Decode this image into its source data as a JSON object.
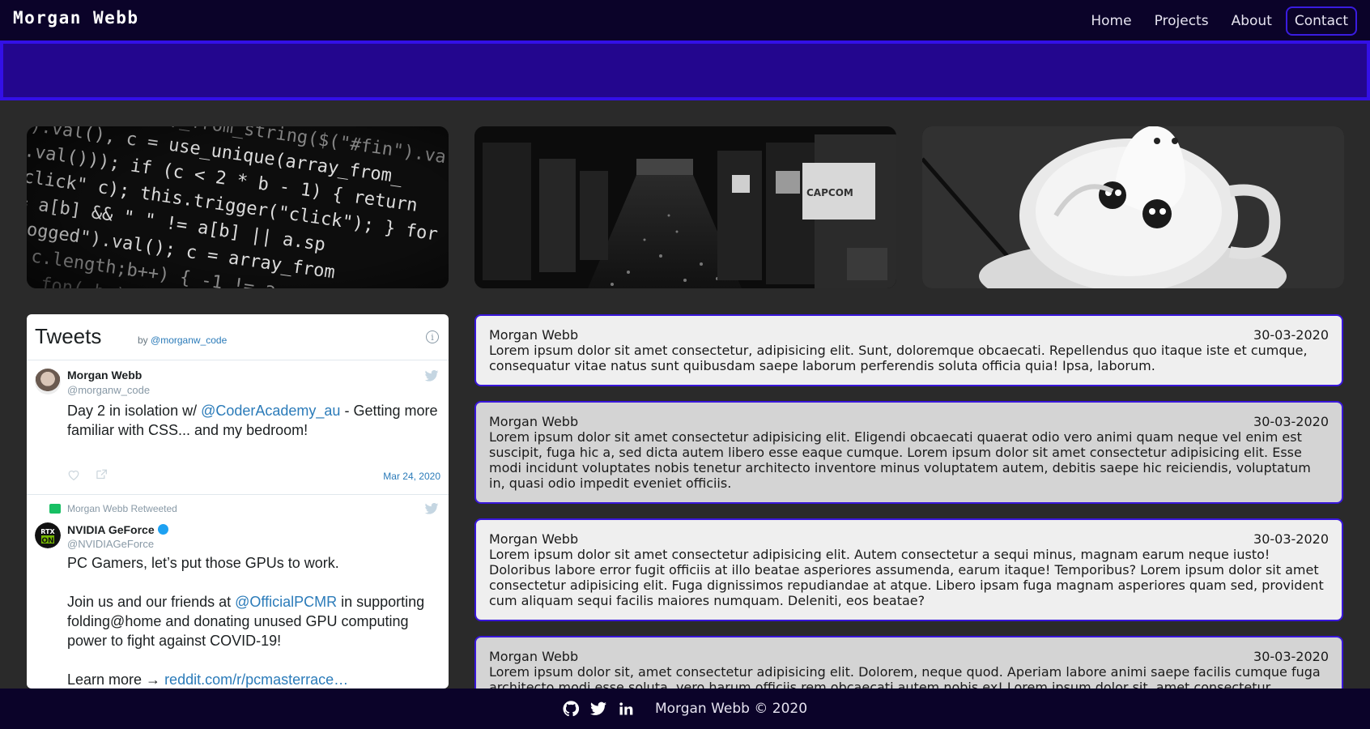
{
  "nav": {
    "brand": "Morgan Webb",
    "links": [
      {
        "label": "Home"
      },
      {
        "label": "Projects"
      },
      {
        "label": "About"
      },
      {
        "label": "Contact",
        "active": true
      }
    ]
  },
  "gallery": [
    {
      "name": "code-screen-image",
      "caption": "tring($(\"#fin\").va, c = use_unique(array_from_, this.trigger(\"click\"); } return"
    },
    {
      "name": "arcade-image",
      "caption": "CAPCOM"
    },
    {
      "name": "latte-art-image",
      "caption": ""
    }
  ],
  "tweets": {
    "title": "Tweets",
    "by": "by",
    "by_handle": "@morganw_code",
    "items": [
      {
        "name": "Morgan Webb",
        "handle": "@morganw_code",
        "text_pre": "Day 2 in isolation w/ ",
        "text_link": "@CoderAcademy_au",
        "text_post": " - Getting more familiar with CSS... and my bedroom!",
        "date": "Mar 24, 2020"
      },
      {
        "retweet_label": "Morgan Webb Retweeted",
        "name": "NVIDIA GeForce",
        "handle": "@NVIDIAGeForce",
        "line1": "PC Gamers, let’s put those GPUs to work.",
        "line2_pre": "Join us and our friends at ",
        "line2_link": "@OfficialPCMR",
        "line2_post": " in supporting folding@home and donating unused GPU computing power to fight against COVID-19!",
        "line3_pre": "Learn more → ",
        "line3_link": "reddit.com/r/pcmasterrace…"
      }
    ]
  },
  "posts": [
    {
      "author": "Morgan Webb",
      "date": "30-03-2020",
      "body": "Lorem ipsum dolor sit amet consectetur, adipisicing elit. Sunt, doloremque obcaecati. Repellendus quo itaque iste et cumque, consequatur vitae natus sunt quibusdam saepe laborum perferendis soluta officia quia! Ipsa, laborum."
    },
    {
      "author": "Morgan Webb",
      "date": "30-03-2020",
      "body": "Lorem ipsum dolor sit amet consectetur adipisicing elit. Eligendi obcaecati quaerat odio vero animi quam neque vel enim est suscipit, fuga hic a, sed dicta autem libero esse eaque cumque. Lorem ipsum dolor sit amet consectetur adipisicing elit. Esse modi incidunt voluptates nobis tenetur architecto inventore minus voluptatem autem, debitis saepe hic reiciendis, voluptatum in, quasi odio impedit eveniet officiis."
    },
    {
      "author": "Morgan Webb",
      "date": "30-03-2020",
      "body": "Lorem ipsum dolor sit amet consectetur adipisicing elit. Autem consectetur a sequi minus, magnam earum neque iusto! Doloribus labore error fugit officiis at illo beatae asperiores assumenda, earum itaque! Temporibus? Lorem ipsum dolor sit amet consectetur adipisicing elit. Fuga dignissimos repudiandae at atque. Libero ipsam fuga magnam asperiores quam sed, provident cum aliquam sequi facilis maiores numquam. Deleniti, eos beatae?"
    },
    {
      "author": "Morgan Webb",
      "date": "30-03-2020",
      "body": "Lorem ipsum dolor sit, amet consectetur adipisicing elit. Dolorem, neque quod. Aperiam labore animi saepe facilis cumque fuga architecto modi esse soluta, vero harum officiis rem obcaecati autem nobis ex! Lorem ipsum dolor sit, amet consectetur"
    }
  ],
  "footer": {
    "icons": [
      "github-icon",
      "twitter-icon",
      "linkedin-icon"
    ],
    "copyright": "Morgan Webb © 2020"
  },
  "colors": {
    "nav_bg": "#0b0329",
    "banner_bg": "#23068e",
    "accent": "#3816d9",
    "page_bg": "#2a2a2a"
  }
}
